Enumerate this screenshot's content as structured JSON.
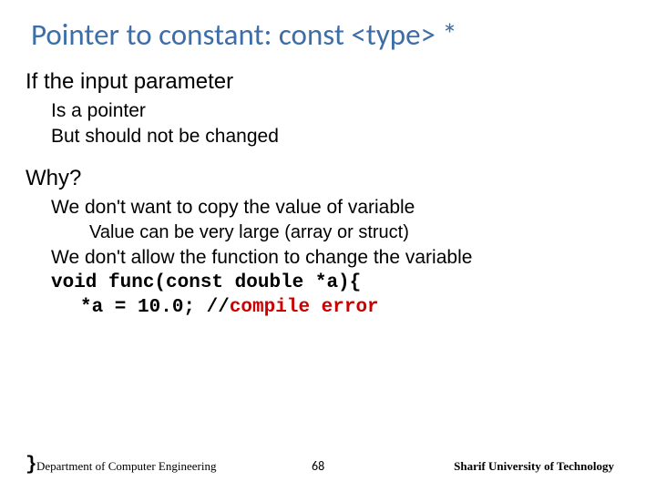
{
  "title": "Pointer to constant: const <type> *",
  "b1": "If the input parameter",
  "b1a": "Is a pointer",
  "b1b": "But should not be changed",
  "b2": "Why?",
  "b2a": "We don't want to copy the value of variable",
  "b2a1": "Value can be very large (array or struct)",
  "b2b": "We don't allow the function to change the variable",
  "code1": "void func(const double *a){",
  "code2a": "*a = 10.0; //",
  "code2b": "compile error",
  "code3": "}",
  "footer": {
    "dept": "Department of Computer Engineering",
    "page": "68",
    "univ": "Sharif University of Technology"
  }
}
